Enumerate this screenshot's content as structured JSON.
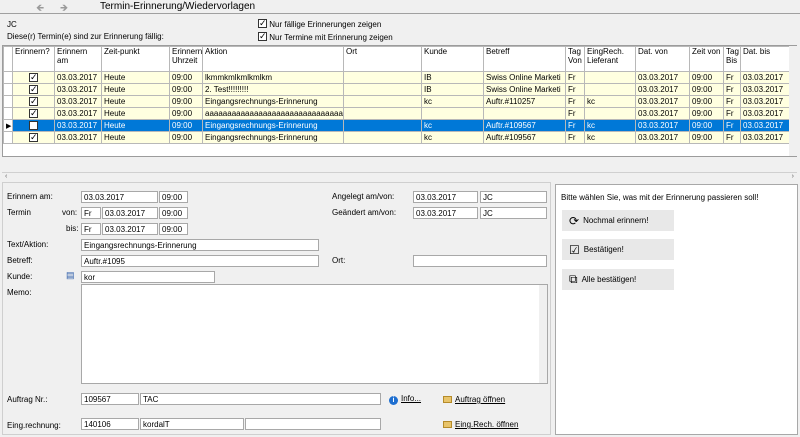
{
  "window": {
    "title": "Termin-Erinnerung/Wiedervorlagen"
  },
  "header": {
    "user": "JC",
    "due_text": "Diese(r) Termin(e) sind zur Erinnerung fällig:",
    "opt_due_only": "Nur fällige Erinnerungen zeigen",
    "opt_with_reminder": "Nur Termine mit Erinnerung zeigen"
  },
  "grid": {
    "columns": [
      "Erinnern?",
      "Erinnern am",
      "Zeit-punkt",
      "Erinnern Uhrzeit",
      "Aktion",
      "Ort",
      "Kunde",
      "Betreff",
      "Tag Von",
      "EingRech. Lieferant",
      "Dat. von",
      "Zeit von",
      "Tag Bis",
      "Dat. bis"
    ],
    "rows": [
      [
        "03.03.2017",
        "Heute",
        "09:00",
        "lkmmkmlkmlkmlkm",
        "",
        "IB",
        "Swiss Online Marketi",
        "Fr",
        "",
        "03.03.2017",
        "09:00",
        "Fr",
        "03.03.2017"
      ],
      [
        "03.03.2017",
        "Heute",
        "09:00",
        "2. Test!!!!!!!!!",
        "",
        "IB",
        "Swiss Online Marketi",
        "Fr",
        "",
        "03.03.2017",
        "09:00",
        "Fr",
        "03.03.2017"
      ],
      [
        "03.03.2017",
        "Heute",
        "09:00",
        "Eingangsrechnungs-Erinnerung",
        "",
        "kc",
        "Auftr.#110257",
        "Fr",
        "kc",
        "03.03.2017",
        "09:00",
        "Fr",
        "03.03.2017"
      ],
      [
        "03.03.2017",
        "Heute",
        "09:00",
        "aaaaaaaaaaaaaaaaaaaaaaaaaaaaaaa",
        "",
        "",
        "",
        "Fr",
        "",
        "03.03.2017",
        "09:00",
        "Fr",
        "03.03.2017"
      ],
      [
        "03.03.2017",
        "Heute",
        "09:00",
        "Eingangsrechnungs-Erinnerung",
        "",
        "kc",
        "Auftr.#109567",
        "Fr",
        "kc",
        "03.03.2017",
        "09:00",
        "Fr",
        "03.03.2017"
      ],
      [
        "03.03.2017",
        "Heute",
        "09:00",
        "Eingangsrechnungs-Erinnerung",
        "",
        "kc",
        "Auftr.#109567",
        "Fr",
        "kc",
        "03.03.2017",
        "09:00",
        "Fr",
        "03.03.2017"
      ]
    ],
    "selected_row": 4
  },
  "form": {
    "erinnern_label": "Erinnern am:",
    "erinnern_date": "03.03.2017",
    "erinnern_time": "09:00",
    "termin_label": "Termin",
    "von_label": "von:",
    "bis_label": "bis:",
    "von_day": "Fr",
    "von_date": "03.03.2017",
    "von_time": "09:00",
    "bis_day": "Fr",
    "bis_date": "03.03.2017",
    "bis_time": "09:00",
    "angelegt_label": "Angelegt am/von:",
    "angelegt_date": "03.03.2017",
    "angelegt_user": "JC",
    "geaendert_label": "Geändert am/von:",
    "geaendert_date": "03.03.2017",
    "geaendert_user": "JC",
    "text_label": "Text/Aktion:",
    "text_value": "Eingangsrechnungs-Erinnerung",
    "betreff_label": "Betreff:",
    "betreff_value": "Auftr.#1095",
    "ort_label": "Ort:",
    "ort_value": "",
    "kunde_label": "Kunde:",
    "kunde_value": "kor",
    "memo_label": "Memo:",
    "memo_value": "",
    "auftrag_label": "Auftrag Nr.:",
    "auftrag_nr": "109567",
    "auftrag_name": "TAC",
    "info_link": "Info...",
    "auftrag_link": "Auftrag öffnen",
    "eingrech_label": "Eing.rechnung:",
    "eingrech_nr": "140106",
    "eingrech_name": "kordalT",
    "eingrech_link": "Eing.Rech. öffnen"
  },
  "actions": {
    "prompt": "Bitte wählen Sie, was mit der Erinnerung passieren soll!",
    "remind_again": "Nochmal erinnern!",
    "confirm": "Bestätigen!",
    "confirm_all": "Alle bestätigen!"
  }
}
